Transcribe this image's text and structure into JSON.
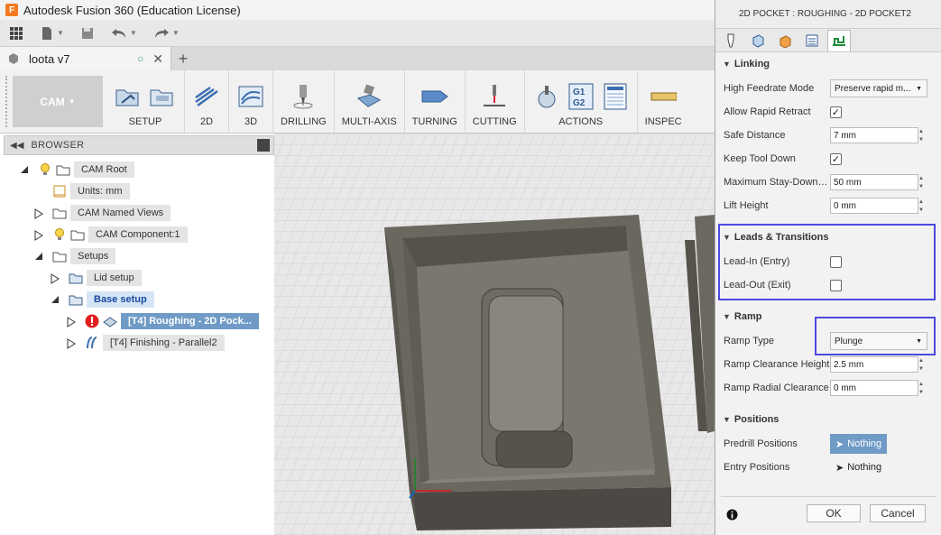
{
  "app": {
    "title": "Autodesk Fusion 360 (Education License)"
  },
  "document": {
    "tab_name": "loota v7"
  },
  "toolbar": {
    "workspace_label": "CAM",
    "groups": [
      {
        "label": "SETUP"
      },
      {
        "label": "2D"
      },
      {
        "label": "3D"
      },
      {
        "label": "DRILLING"
      },
      {
        "label": "MULTI-AXIS"
      },
      {
        "label": "TURNING"
      },
      {
        "label": "CUTTING"
      },
      {
        "label": "ACTIONS"
      },
      {
        "label": "INSPEC"
      }
    ],
    "actions_g1g2": "G1\nG2"
  },
  "browser": {
    "title": "BROWSER",
    "nodes": [
      {
        "label": "CAM Root"
      },
      {
        "label": "Units: mm"
      },
      {
        "label": "CAM Named Views"
      },
      {
        "label": "CAM Component:1"
      },
      {
        "label": "Setups"
      },
      {
        "label": "Lid setup"
      },
      {
        "label": "Base setup"
      },
      {
        "label": "[T4] Roughing - 2D Pock..."
      },
      {
        "label": "[T4] Finishing - Parallel2"
      }
    ]
  },
  "panel": {
    "header": "2D POCKET : ROUGHING - 2D POCKET2",
    "sections": {
      "linking": "Linking",
      "leads": "Leads & Transitions",
      "ramp": "Ramp",
      "positions": "Positions"
    },
    "fields": {
      "high_feedrate_mode": {
        "label": "High Feedrate Mode",
        "value": "Preserve rapid m..."
      },
      "allow_rapid_retract": {
        "label": "Allow Rapid Retract",
        "checked": true
      },
      "safe_distance": {
        "label": "Safe Distance",
        "value": "7 mm"
      },
      "keep_tool_down": {
        "label": "Keep Tool Down",
        "checked": true
      },
      "max_stay_down": {
        "label": "Maximum Stay-Down Distance",
        "value": "50 mm"
      },
      "lift_height": {
        "label": "Lift Height",
        "value": "0 mm"
      },
      "lead_in": {
        "label": "Lead-In (Entry)",
        "checked": false
      },
      "lead_out": {
        "label": "Lead-Out (Exit)",
        "checked": false
      },
      "ramp_type": {
        "label": "Ramp Type",
        "value": "Plunge"
      },
      "ramp_clearance_height": {
        "label": "Ramp Clearance Height",
        "value": "2.5 mm"
      },
      "ramp_radial_clearance": {
        "label": "Ramp Radial Clearance",
        "value": "0 mm"
      },
      "predrill_positions": {
        "label": "Predrill Positions",
        "value": "Nothing"
      },
      "entry_positions": {
        "label": "Entry Positions",
        "value": "Nothing"
      }
    },
    "ok_label": "OK",
    "cancel_label": "Cancel"
  },
  "colors": {
    "highlight_box": "#4a4adf",
    "selected_node": "#6f9bc6",
    "part": "#5e5b54"
  }
}
